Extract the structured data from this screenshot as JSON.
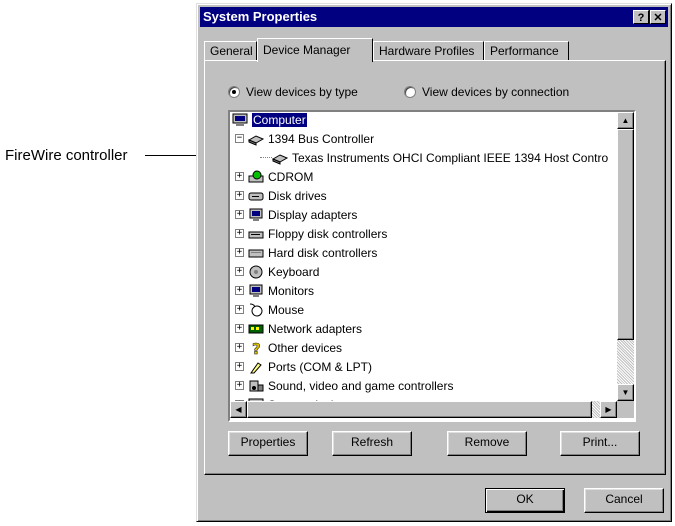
{
  "callout": {
    "text": "FireWire controller"
  },
  "window": {
    "title": "System Properties",
    "help_btn": "?",
    "close_btn": "✕"
  },
  "tabs": [
    "General",
    "Device Manager",
    "Hardware Profiles",
    "Performance"
  ],
  "view_options": [
    {
      "label": "View devices by type",
      "selected": true
    },
    {
      "label": "View devices by connection",
      "selected": false
    }
  ],
  "tree": [
    {
      "label": "Computer",
      "level": 0,
      "icon": "computer-icon",
      "selected": true,
      "toggle": ""
    },
    {
      "label": "1394 Bus Controller",
      "level": 1,
      "icon": "controller-icon",
      "toggle": "−"
    },
    {
      "label": "Texas Instruments OHCI Compliant IEEE 1394 Host Contro",
      "level": 2,
      "icon": "controller-icon",
      "toggle": ""
    },
    {
      "label": "CDROM",
      "level": 1,
      "icon": "cdrom-icon",
      "toggle": "+"
    },
    {
      "label": "Disk drives",
      "level": 1,
      "icon": "disk-drive-icon",
      "toggle": "+"
    },
    {
      "label": "Display adapters",
      "level": 1,
      "icon": "monitor-icon",
      "toggle": "+"
    },
    {
      "label": "Floppy disk controllers",
      "level": 1,
      "icon": "floppy-icon",
      "toggle": "+"
    },
    {
      "label": "Hard disk controllers",
      "level": 1,
      "icon": "hard-disk-icon",
      "toggle": "+"
    },
    {
      "label": "Keyboard",
      "level": 1,
      "icon": "keyboard-icon",
      "toggle": "+"
    },
    {
      "label": "Monitors",
      "level": 1,
      "icon": "monitor-icon",
      "toggle": "+"
    },
    {
      "label": "Mouse",
      "level": 1,
      "icon": "mouse-icon",
      "toggle": "+"
    },
    {
      "label": "Network adapters",
      "level": 1,
      "icon": "network-icon",
      "toggle": "+"
    },
    {
      "label": "Other devices",
      "level": 1,
      "icon": "question-icon",
      "toggle": "+"
    },
    {
      "label": "Ports (COM & LPT)",
      "level": 1,
      "icon": "port-icon",
      "toggle": "+"
    },
    {
      "label": "Sound, video and game controllers",
      "level": 1,
      "icon": "sound-icon",
      "toggle": "+"
    },
    {
      "label": "System devices",
      "level": 1,
      "icon": "computer-icon",
      "toggle": "+"
    }
  ],
  "buttons": [
    "Properties",
    "Refresh",
    "Remove",
    "Print..."
  ],
  "dialog_buttons": {
    "ok": "OK",
    "cancel": "Cancel"
  },
  "colors": {
    "title_bar": "#000080",
    "face": "#c0c0c0",
    "selection": "#000080"
  }
}
